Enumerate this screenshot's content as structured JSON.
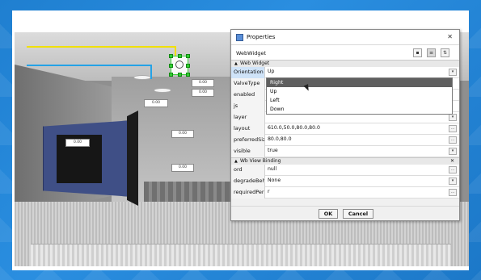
{
  "dialog": {
    "title": "Properties",
    "close_icon": "close-icon",
    "subtitle": "WebWidget",
    "view_buttons": [
      "grid-view-icon",
      "list-view-icon",
      "sort-icon"
    ],
    "sections": [
      {
        "title": "Web Widget",
        "rows": [
          {
            "name": "Orientation",
            "value": "Up",
            "button": "▾"
          },
          {
            "name": "ValveType",
            "value": "",
            "button": ""
          },
          {
            "name": "enabled",
            "value": "",
            "button": ""
          },
          {
            "name": "js",
            "value": "",
            "button": ""
          },
          {
            "name": "layer",
            "value": "",
            "button": "▾"
          },
          {
            "name": "layout",
            "value": "610.0,50.0,80.0,80.0",
            "button": "..."
          },
          {
            "name": "preferredSize",
            "value": "80.0,80.0",
            "button": "..."
          },
          {
            "name": "visible",
            "value": "true",
            "button": "▾"
          }
        ]
      },
      {
        "title": "Wb View Binding",
        "rows": [
          {
            "name": "ord",
            "value": "null",
            "button": "..."
          },
          {
            "name": "degradeBehav",
            "value": "None",
            "button": "▾"
          },
          {
            "name": "requiredPerm",
            "value": "r",
            "button": "..."
          }
        ]
      }
    ],
    "dropdown_options": [
      "Right",
      "Up",
      "Left",
      "Down"
    ],
    "dropdown_selected_index": 0,
    "ok_label": "OK",
    "cancel_label": "Cancel"
  },
  "scene": {
    "value_boxes": [
      "0.00",
      "0.00",
      "0.00",
      "0.00",
      "0.00",
      "0.00",
      "0.00",
      "0.00"
    ],
    "pipe_colors": {
      "yellow": "#f0e000",
      "blue": "#25a2e6"
    },
    "selection_color": "#2fcf2f"
  }
}
